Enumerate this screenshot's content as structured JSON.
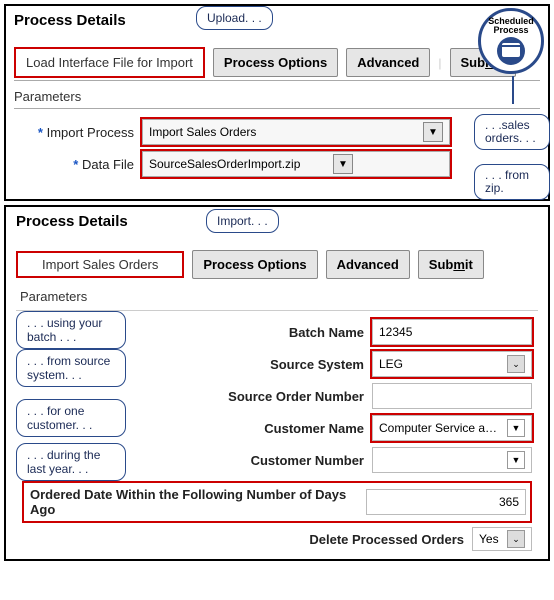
{
  "top": {
    "heading": "Process Details",
    "title_box": "Load Interface File for Import",
    "callout_upload": "Upload. . .",
    "btn_options": "Process Options",
    "btn_advanced": "Advanced",
    "btn_submit_pre": "Sub",
    "btn_submit_accel": "m",
    "btn_submit_post": "it",
    "params_label": "Parameters",
    "lbl_import_process": "Import Process",
    "val_import_process": "Import Sales Orders",
    "lbl_data_file": "Data File",
    "val_data_file": "SourceSalesOrderImport.zip",
    "callout_sales": ". . .sales orders. . .",
    "callout_zip": ". . . from zip.",
    "badge_l1": "Scheduled",
    "badge_l2": "Process"
  },
  "bottom": {
    "heading": "Process Details",
    "title_box": "Import Sales Orders",
    "callout_import": "Import. . .",
    "btn_options": "Process Options",
    "btn_advanced": "Advanced",
    "btn_submit_pre": "Sub",
    "btn_submit_accel": "m",
    "btn_submit_post": "it",
    "params_label": "Parameters",
    "callout_batch": ". . . using your batch . . .",
    "callout_source": ". . . from source system. . .",
    "callout_customer": ". . . for one customer. . .",
    "callout_year": ". . . during the last year. . .",
    "lbl_batch": "Batch Name",
    "val_batch": "12345",
    "lbl_src_sys": "Source System",
    "val_src_sys": "LEG",
    "lbl_src_ord": "Source Order Number",
    "val_src_ord": "",
    "lbl_cust_name": "Customer Name",
    "val_cust_name": "Computer Service and R",
    "lbl_cust_num": "Customer Number",
    "val_cust_num": "",
    "lbl_days": "Ordered Date Within the Following Number of Days Ago",
    "val_days": "365",
    "lbl_delete": "Delete Processed Orders",
    "val_delete": "Yes"
  }
}
